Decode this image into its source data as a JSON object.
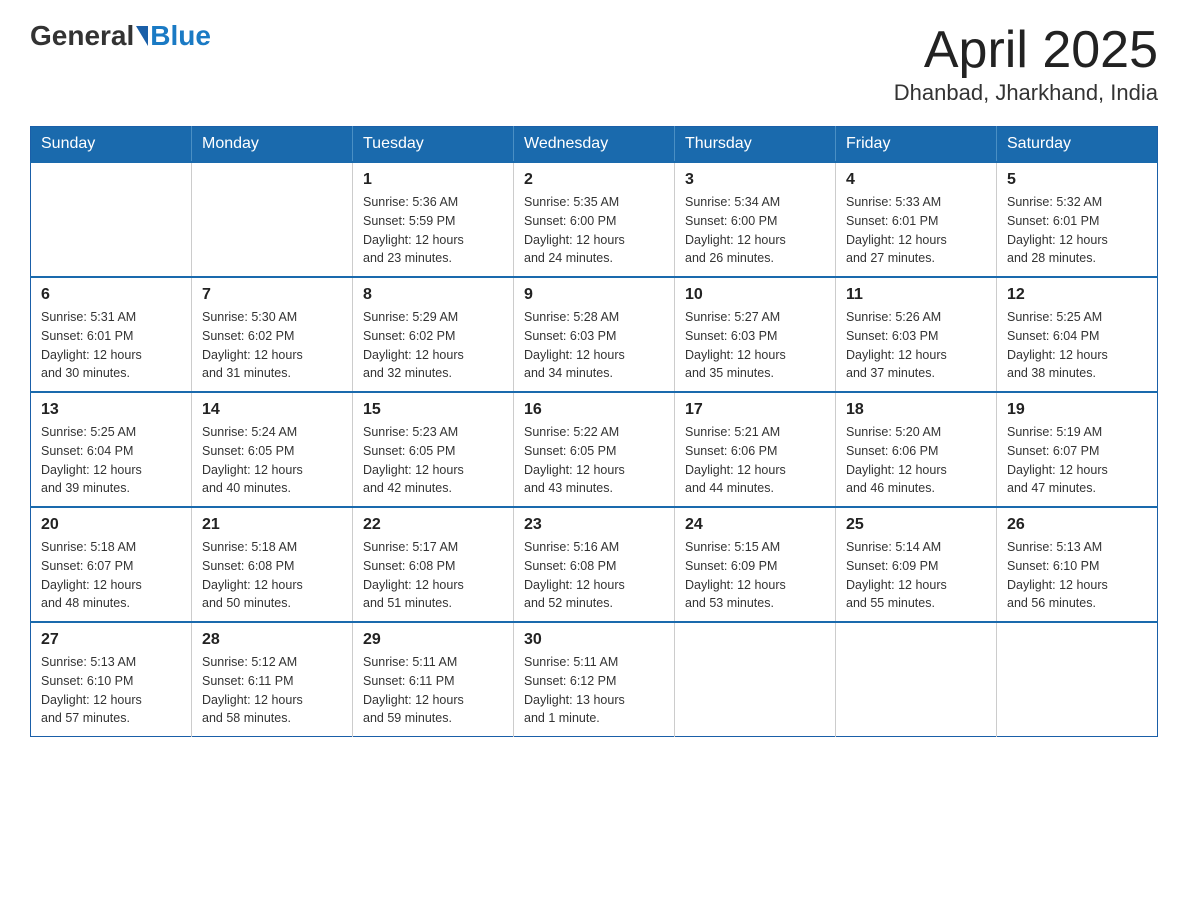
{
  "header": {
    "logo": {
      "general": "General",
      "blue": "Blue"
    },
    "title": "April 2025",
    "subtitle": "Dhanbad, Jharkhand, India"
  },
  "weekdays": [
    "Sunday",
    "Monday",
    "Tuesday",
    "Wednesday",
    "Thursday",
    "Friday",
    "Saturday"
  ],
  "weeks": [
    [
      {
        "day": "",
        "info": ""
      },
      {
        "day": "",
        "info": ""
      },
      {
        "day": "1",
        "info": "Sunrise: 5:36 AM\nSunset: 5:59 PM\nDaylight: 12 hours\nand 23 minutes."
      },
      {
        "day": "2",
        "info": "Sunrise: 5:35 AM\nSunset: 6:00 PM\nDaylight: 12 hours\nand 24 minutes."
      },
      {
        "day": "3",
        "info": "Sunrise: 5:34 AM\nSunset: 6:00 PM\nDaylight: 12 hours\nand 26 minutes."
      },
      {
        "day": "4",
        "info": "Sunrise: 5:33 AM\nSunset: 6:01 PM\nDaylight: 12 hours\nand 27 minutes."
      },
      {
        "day": "5",
        "info": "Sunrise: 5:32 AM\nSunset: 6:01 PM\nDaylight: 12 hours\nand 28 minutes."
      }
    ],
    [
      {
        "day": "6",
        "info": "Sunrise: 5:31 AM\nSunset: 6:01 PM\nDaylight: 12 hours\nand 30 minutes."
      },
      {
        "day": "7",
        "info": "Sunrise: 5:30 AM\nSunset: 6:02 PM\nDaylight: 12 hours\nand 31 minutes."
      },
      {
        "day": "8",
        "info": "Sunrise: 5:29 AM\nSunset: 6:02 PM\nDaylight: 12 hours\nand 32 minutes."
      },
      {
        "day": "9",
        "info": "Sunrise: 5:28 AM\nSunset: 6:03 PM\nDaylight: 12 hours\nand 34 minutes."
      },
      {
        "day": "10",
        "info": "Sunrise: 5:27 AM\nSunset: 6:03 PM\nDaylight: 12 hours\nand 35 minutes."
      },
      {
        "day": "11",
        "info": "Sunrise: 5:26 AM\nSunset: 6:03 PM\nDaylight: 12 hours\nand 37 minutes."
      },
      {
        "day": "12",
        "info": "Sunrise: 5:25 AM\nSunset: 6:04 PM\nDaylight: 12 hours\nand 38 minutes."
      }
    ],
    [
      {
        "day": "13",
        "info": "Sunrise: 5:25 AM\nSunset: 6:04 PM\nDaylight: 12 hours\nand 39 minutes."
      },
      {
        "day": "14",
        "info": "Sunrise: 5:24 AM\nSunset: 6:05 PM\nDaylight: 12 hours\nand 40 minutes."
      },
      {
        "day": "15",
        "info": "Sunrise: 5:23 AM\nSunset: 6:05 PM\nDaylight: 12 hours\nand 42 minutes."
      },
      {
        "day": "16",
        "info": "Sunrise: 5:22 AM\nSunset: 6:05 PM\nDaylight: 12 hours\nand 43 minutes."
      },
      {
        "day": "17",
        "info": "Sunrise: 5:21 AM\nSunset: 6:06 PM\nDaylight: 12 hours\nand 44 minutes."
      },
      {
        "day": "18",
        "info": "Sunrise: 5:20 AM\nSunset: 6:06 PM\nDaylight: 12 hours\nand 46 minutes."
      },
      {
        "day": "19",
        "info": "Sunrise: 5:19 AM\nSunset: 6:07 PM\nDaylight: 12 hours\nand 47 minutes."
      }
    ],
    [
      {
        "day": "20",
        "info": "Sunrise: 5:18 AM\nSunset: 6:07 PM\nDaylight: 12 hours\nand 48 minutes."
      },
      {
        "day": "21",
        "info": "Sunrise: 5:18 AM\nSunset: 6:08 PM\nDaylight: 12 hours\nand 50 minutes."
      },
      {
        "day": "22",
        "info": "Sunrise: 5:17 AM\nSunset: 6:08 PM\nDaylight: 12 hours\nand 51 minutes."
      },
      {
        "day": "23",
        "info": "Sunrise: 5:16 AM\nSunset: 6:08 PM\nDaylight: 12 hours\nand 52 minutes."
      },
      {
        "day": "24",
        "info": "Sunrise: 5:15 AM\nSunset: 6:09 PM\nDaylight: 12 hours\nand 53 minutes."
      },
      {
        "day": "25",
        "info": "Sunrise: 5:14 AM\nSunset: 6:09 PM\nDaylight: 12 hours\nand 55 minutes."
      },
      {
        "day": "26",
        "info": "Sunrise: 5:13 AM\nSunset: 6:10 PM\nDaylight: 12 hours\nand 56 minutes."
      }
    ],
    [
      {
        "day": "27",
        "info": "Sunrise: 5:13 AM\nSunset: 6:10 PM\nDaylight: 12 hours\nand 57 minutes."
      },
      {
        "day": "28",
        "info": "Sunrise: 5:12 AM\nSunset: 6:11 PM\nDaylight: 12 hours\nand 58 minutes."
      },
      {
        "day": "29",
        "info": "Sunrise: 5:11 AM\nSunset: 6:11 PM\nDaylight: 12 hours\nand 59 minutes."
      },
      {
        "day": "30",
        "info": "Sunrise: 5:11 AM\nSunset: 6:12 PM\nDaylight: 13 hours\nand 1 minute."
      },
      {
        "day": "",
        "info": ""
      },
      {
        "day": "",
        "info": ""
      },
      {
        "day": "",
        "info": ""
      }
    ]
  ]
}
